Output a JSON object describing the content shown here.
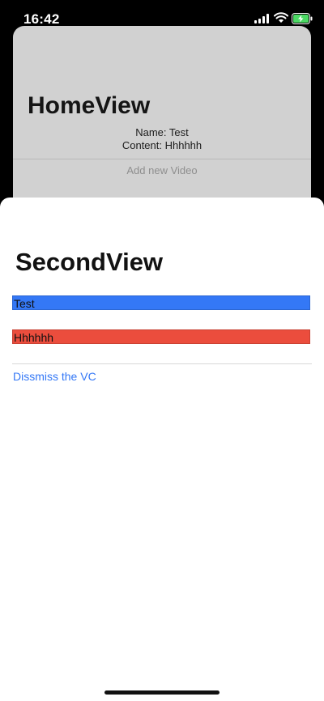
{
  "status_bar": {
    "time": "16:42",
    "icons": [
      "cellular-signal-icon",
      "wifi-icon",
      "battery-charging-icon"
    ]
  },
  "home_view": {
    "title": "HomeView",
    "name_line": "Name: Test",
    "content_line": "Content: Hhhhhh",
    "add_video_label": "Add new Video"
  },
  "second_view": {
    "title": "SecondView",
    "name_field": {
      "value": "Test",
      "background": "#3478f6"
    },
    "content_field": {
      "value": "Hhhhhh",
      "background": "#eb4d3d"
    },
    "dismiss_label": "Dissmiss the VC",
    "link_color": "#3478f6"
  }
}
